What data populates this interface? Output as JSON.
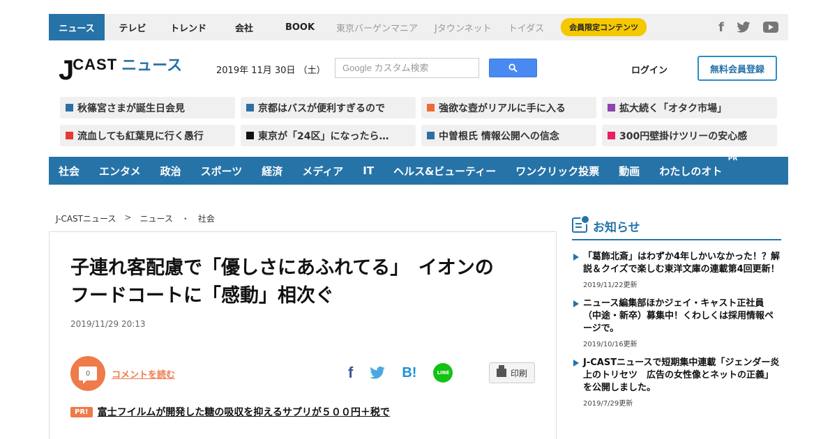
{
  "topnav": {
    "tabs": [
      "ニュース",
      "テレビ",
      "トレンド",
      "会社",
      "BOOK"
    ],
    "gray_links": [
      "東京バーゲンマニア",
      "Jタウンネット",
      "トイダス"
    ],
    "member_badge": "会員限定コンテンツ",
    "social_icons": [
      "facebook-icon",
      "twitter-icon",
      "youtube-icon"
    ]
  },
  "header": {
    "logo_j": "J",
    "logo_cast": "CAST",
    "logo_news": "ニュース",
    "date": "2019年 11月 30日 （土）",
    "search_placeholder": "Google カスタム検索",
    "login": "ログイン",
    "register": "無料会員登録"
  },
  "trending": [
    {
      "label": "秋篠宮さまが誕生日会見",
      "color": "#2d6fa3"
    },
    {
      "label": "京都はバスが便利すぎるので",
      "color": "#2d6fa3"
    },
    {
      "label": "強欲な壺がリアルに手に入る",
      "color": "#ef6a3a"
    },
    {
      "label": "拡大続く「オタク市場」",
      "color": "#8e44ad"
    },
    {
      "label": "流血しても紅葉見に行く愚行",
      "color": "#e53935"
    },
    {
      "label": "東京が「24区」になったら…",
      "color": "#111111"
    },
    {
      "label": "中曽根氏 情報公開への信念",
      "color": "#2d6fa3"
    },
    {
      "label": "300円壁掛けツリーの安心感",
      "color": "#e91e63"
    }
  ],
  "categories": [
    "社会",
    "エンタメ",
    "政治",
    "スポーツ",
    "経済",
    "メディア",
    "IT",
    "ヘルス&ビューティー",
    "ワンクリック投票",
    "動画",
    "わたしのオト"
  ],
  "categories_pr": "PR",
  "breadcrumb": [
    "J-CASTニュース",
    ">",
    "ニュース",
    "・",
    "社会"
  ],
  "article": {
    "title_line1": "子連れ客配慮で「優しさにあふれてる」　イオンの",
    "title_line2": "フードコートに「感動」相次ぐ",
    "date": "2019/11/29 20:13",
    "comment_count": "0",
    "comment_link": "コメントを読む",
    "share": {
      "fb": "f",
      "tw": "🐦",
      "hb": "B!",
      "line": "LINE"
    },
    "print": "印刷",
    "pr_badge": "PR!",
    "pr_link": "富士フイルムが開発した糖の吸収を抑えるサプリが５００円＋税で"
  },
  "sidebar": {
    "heading": "お知らせ",
    "notices": [
      {
        "text": "「葛飾北斎」はわずか4年しかいなかった！？解説＆クイズで楽しむ東洋文庫の連載第4回更新！",
        "updated": "2019/11/22更新"
      },
      {
        "text": "ニュース編集部ほかジェイ・キャスト正社員（中途・新卒）募集中！くわしくは採用情報ページで。",
        "updated": "2019/10/16更新"
      },
      {
        "text": "J-CASTニュースで短期集中連載「ジェンダー炎上のトリセツ　広告の女性像とネットの正義」を公開しました。",
        "updated": "2019/7/29更新"
      }
    ]
  }
}
